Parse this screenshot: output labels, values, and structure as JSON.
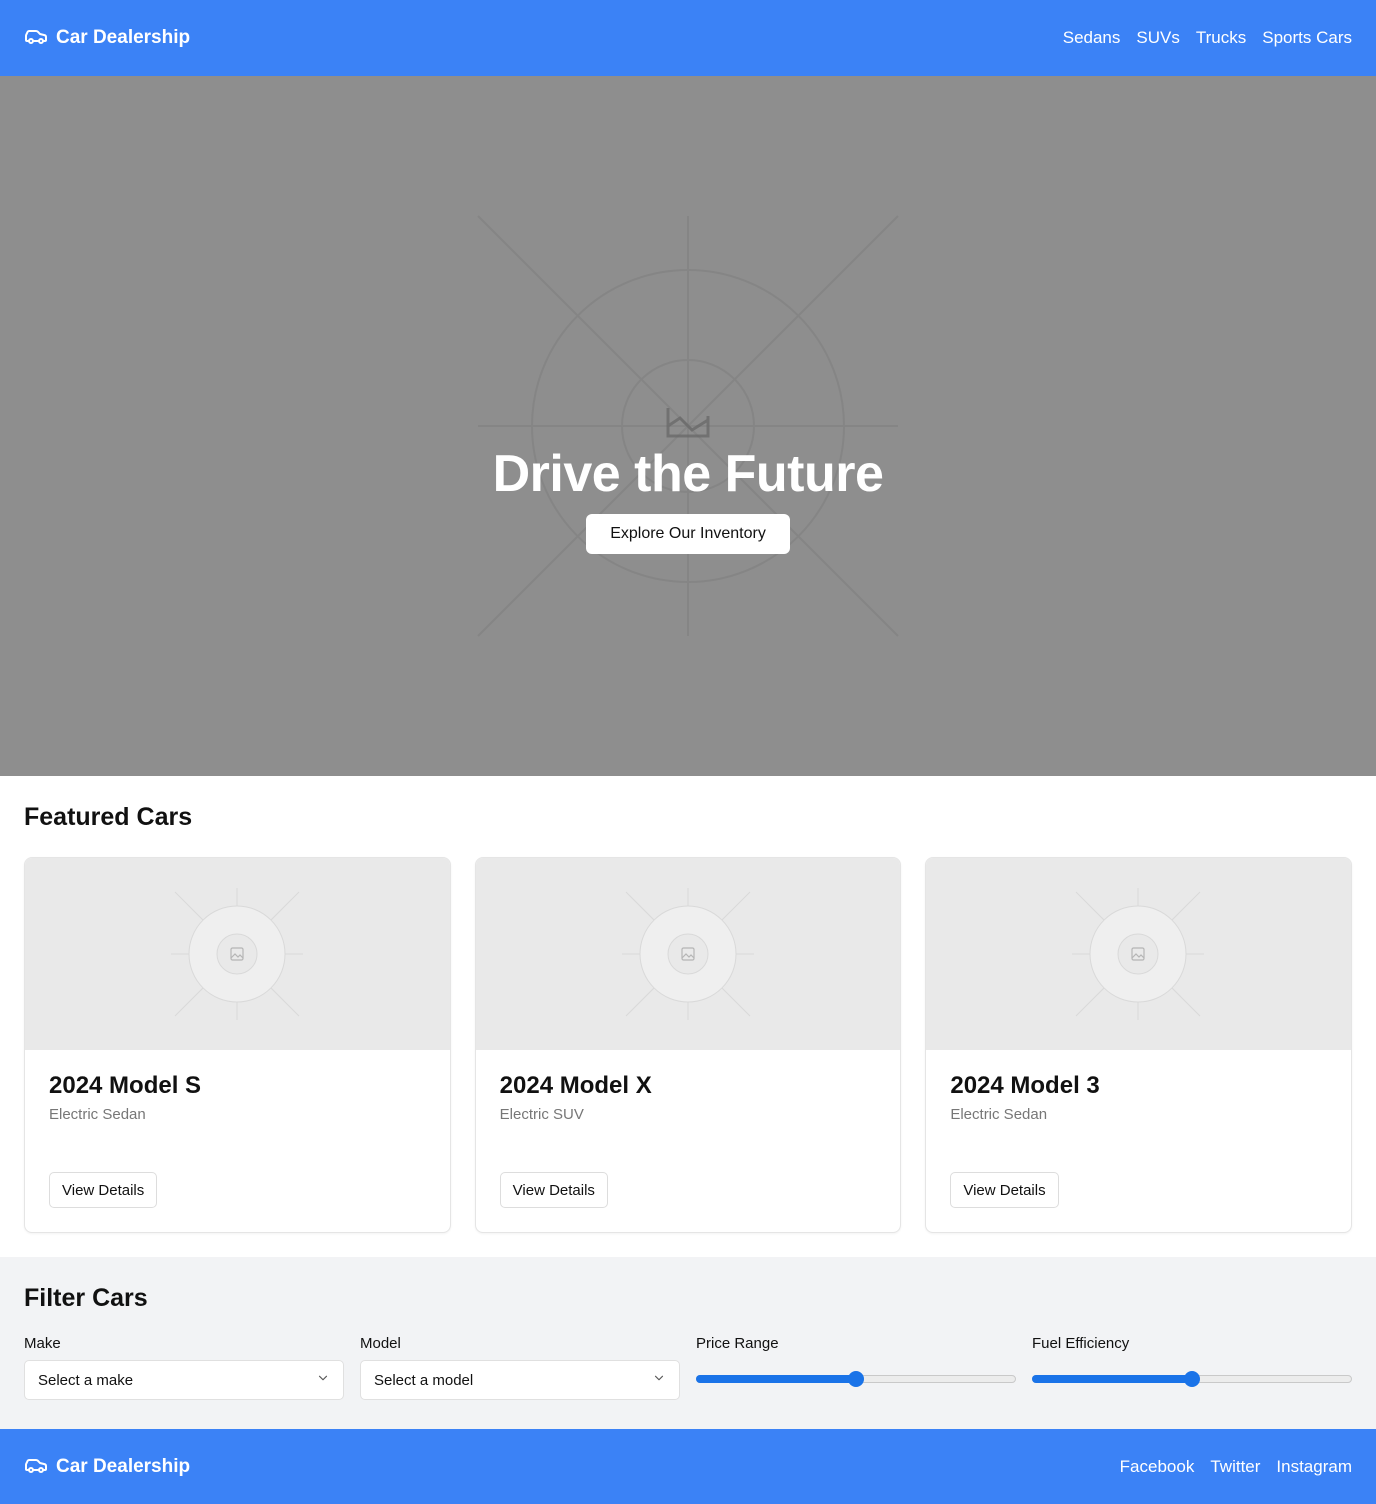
{
  "header": {
    "brand": "Car Dealership",
    "brand_icon": "car-icon",
    "nav": [
      "Sedans",
      "SUVs",
      "Trucks",
      "Sports Cars"
    ]
  },
  "hero": {
    "title": "Drive the Future",
    "cta_label": "Explore Our Inventory"
  },
  "featured": {
    "title": "Featured Cars",
    "cars": [
      {
        "name": "2024 Model S",
        "type": "Electric Sedan",
        "button": "View Details"
      },
      {
        "name": "2024 Model X",
        "type": "Electric SUV",
        "button": "View Details"
      },
      {
        "name": "2024 Model 3",
        "type": "Electric Sedan",
        "button": "View Details"
      }
    ]
  },
  "filters": {
    "title": "Filter Cars",
    "make": {
      "label": "Make",
      "value": "Select a make"
    },
    "model": {
      "label": "Model",
      "value": "Select a model"
    },
    "price": {
      "label": "Price Range",
      "value_fraction": 0.5
    },
    "fuel": {
      "label": "Fuel Efficiency",
      "value_fraction": 0.5
    }
  },
  "footer": {
    "brand": "Car Dealership",
    "links": [
      "Facebook",
      "Twitter",
      "Instagram"
    ]
  },
  "colors": {
    "primary": "#3b82f6",
    "slider": "#1a73e8",
    "hero_bg": "#8e8e8e",
    "section_bg": "#f2f3f5"
  }
}
